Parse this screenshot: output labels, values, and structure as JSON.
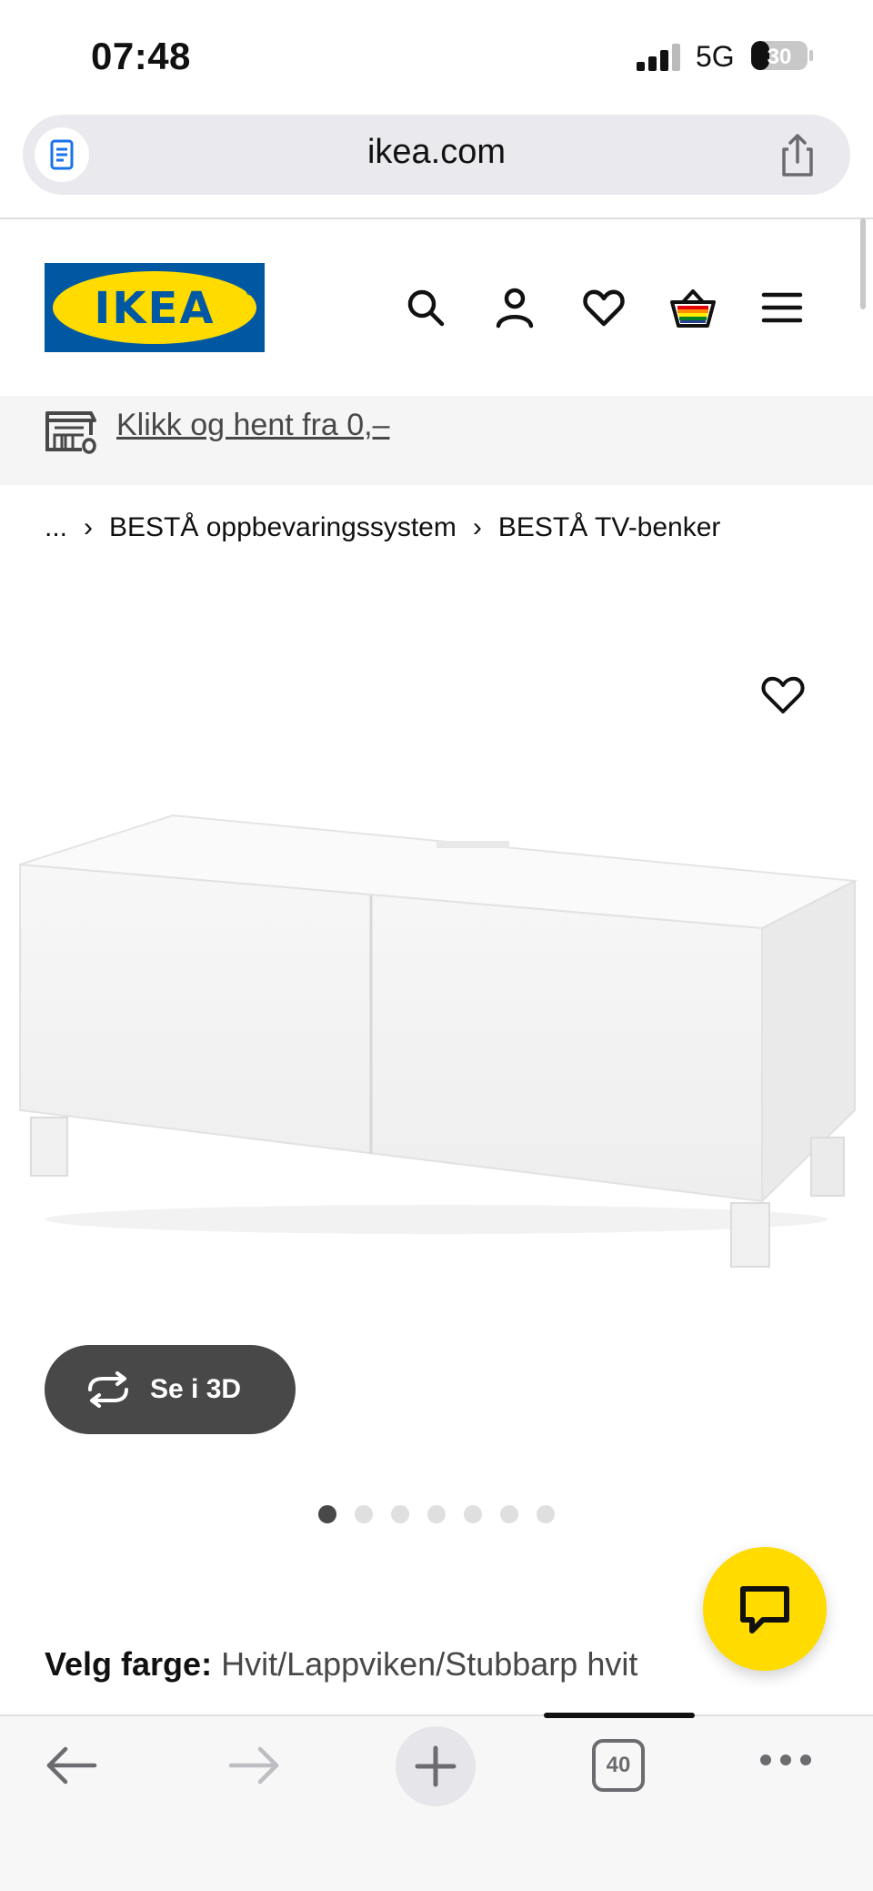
{
  "status_bar": {
    "time": "07:48",
    "network": "5G",
    "battery": "30"
  },
  "browser": {
    "url": "ikea.com",
    "tab_count": "40"
  },
  "header": {
    "logo_text": "IKEA",
    "icons": [
      "search-icon",
      "user-icon",
      "heart-icon",
      "shopping-cart-icon",
      "menu-icon"
    ]
  },
  "promo": {
    "text": "Klikk og hent fra 0,–"
  },
  "breadcrumb": {
    "items": [
      "...",
      "BESTÅ oppbevaringssystem",
      "BESTÅ TV-benker"
    ]
  },
  "product": {
    "view_3d_label": "Se i 3D",
    "image_count": 7,
    "active_image": 1
  },
  "color_select": {
    "label": "Velg farge:",
    "value": "Hvit/Lappviken/Stubbarp hvit"
  },
  "colors": {
    "ikea_blue": "#0058a3",
    "ikea_yellow": "#ffdb00",
    "dark_gray": "#484848"
  }
}
